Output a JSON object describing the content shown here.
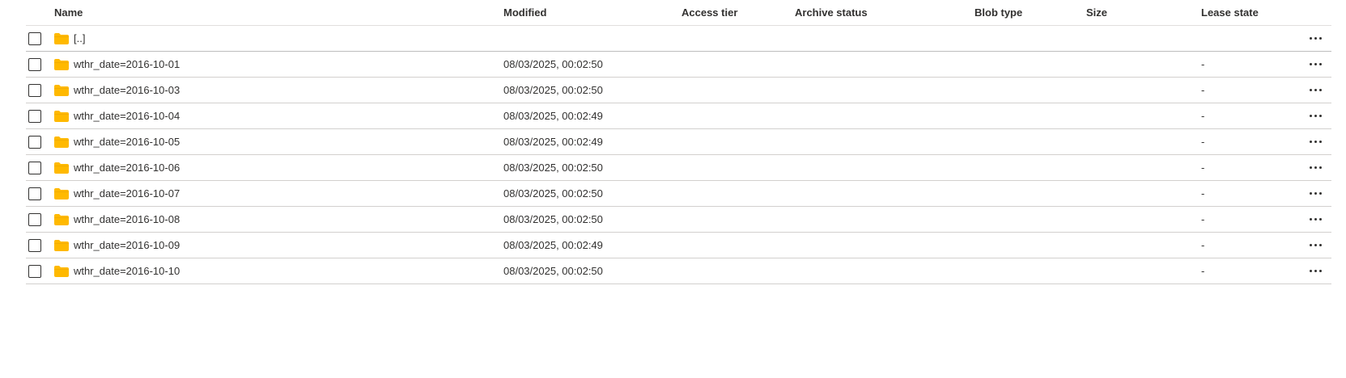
{
  "columns": {
    "name": "Name",
    "modified": "Modified",
    "access_tier": "Access tier",
    "archive_status": "Archive status",
    "blob_type": "Blob type",
    "size": "Size",
    "lease_state": "Lease state"
  },
  "parent": {
    "name": "[..]",
    "modified": "",
    "lease_state": ""
  },
  "rows": [
    {
      "name": "wthr_date=2016-10-01",
      "modified": "08/03/2025, 00:02:50",
      "lease_state": "-"
    },
    {
      "name": "wthr_date=2016-10-03",
      "modified": "08/03/2025, 00:02:50",
      "lease_state": "-"
    },
    {
      "name": "wthr_date=2016-10-04",
      "modified": "08/03/2025, 00:02:49",
      "lease_state": "-"
    },
    {
      "name": "wthr_date=2016-10-05",
      "modified": "08/03/2025, 00:02:49",
      "lease_state": "-"
    },
    {
      "name": "wthr_date=2016-10-06",
      "modified": "08/03/2025, 00:02:50",
      "lease_state": "-"
    },
    {
      "name": "wthr_date=2016-10-07",
      "modified": "08/03/2025, 00:02:50",
      "lease_state": "-"
    },
    {
      "name": "wthr_date=2016-10-08",
      "modified": "08/03/2025, 00:02:50",
      "lease_state": "-"
    },
    {
      "name": "wthr_date=2016-10-09",
      "modified": "08/03/2025, 00:02:49",
      "lease_state": "-"
    },
    {
      "name": "wthr_date=2016-10-10",
      "modified": "08/03/2025, 00:02:50",
      "lease_state": "-"
    }
  ],
  "icons": {
    "folder": "folder-icon",
    "more": "more-options-icon",
    "checkbox": "checkbox"
  },
  "colors": {
    "folder": "#FFB900",
    "folder_tab": "#E8A200",
    "divider": "#d2d0ce"
  }
}
